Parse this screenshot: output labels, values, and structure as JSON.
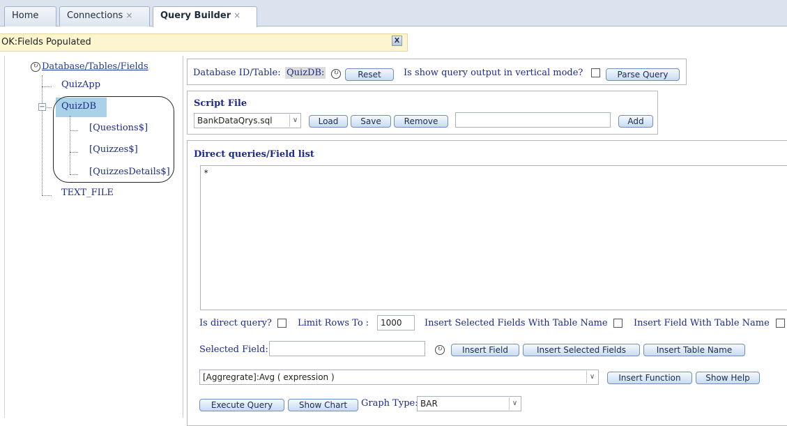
{
  "tabs": [
    {
      "label": "Home",
      "closable": false
    },
    {
      "label": "Connections",
      "closable": true
    },
    {
      "label": "Query Builder",
      "closable": true,
      "active": true
    }
  ],
  "tab_close_glyph": "×",
  "status": {
    "message": "OK:Fields Populated",
    "close_label": "X"
  },
  "tree": {
    "root": "Database/Tables/Fields",
    "nodes": [
      "QuizApp",
      "QuizDB",
      "TEXT_FILE"
    ],
    "quizdb_children": [
      "[Questions$]",
      "[Quizzes$]",
      "[QuizzesDetails$]"
    ],
    "expander_glyph": "−"
  },
  "db_panel": {
    "label": "Database ID/Table:",
    "value": "QuizDB:",
    "reset_label": "Reset",
    "vertical_mode_label": "Is show query output in vertical mode?",
    "parse_label": "Parse Query"
  },
  "script_panel": {
    "title": "Script File",
    "selected_file": "BankDataQrys.sql",
    "load_label": "Load",
    "save_label": "Save",
    "remove_label": "Remove",
    "add_value": "",
    "add_label": "Add"
  },
  "query_panel": {
    "title": "Direct queries/Field list",
    "query_text": "*",
    "direct_query_label": "Is direct query?",
    "limit_label": "Limit Rows To :",
    "limit_value": "1000",
    "insert_selected_with_table_label": "Insert Selected Fields With Table Name",
    "insert_field_with_table_label": "Insert Field With Table Name",
    "selected_field_label": "Selected Field:",
    "selected_field_value": "",
    "insert_field_label": "Insert Field",
    "insert_selected_fields_label": "Insert Selected Fields",
    "insert_table_name_label": "Insert Table Name",
    "function_value": "[Aggregrate]:Avg ( expression )",
    "insert_function_label": "Insert Function",
    "show_help_label": "Show Help",
    "execute_label": "Execute Query",
    "show_chart_label": "Show Chart",
    "graph_type_label": "Graph Type:",
    "graph_type_value": "BAR"
  },
  "icons": {
    "refresh": "refresh-icon",
    "dropdown": "chevron-down-icon",
    "expander": "tree-collapse-icon"
  },
  "colors": {
    "tab_bar": "#dae3ee",
    "status_bg": "#fdf5d0",
    "selection": "#a9d2e8",
    "label_text": "#1c2a8c",
    "button_border": "#6f8fb8"
  }
}
